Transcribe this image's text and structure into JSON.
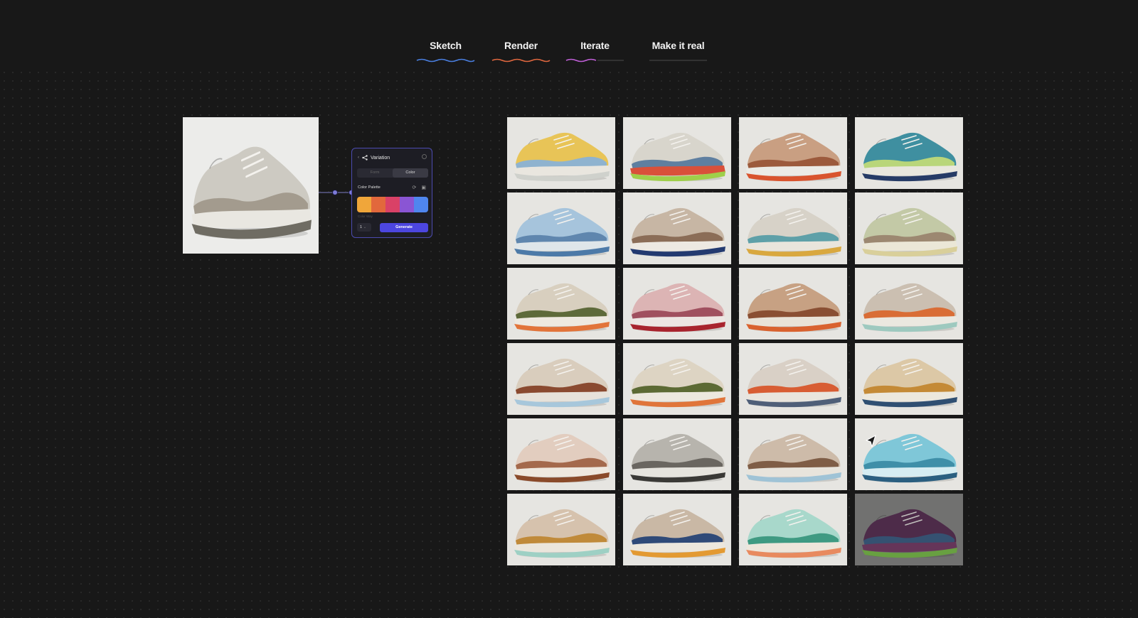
{
  "tabs": [
    {
      "label": "Sketch",
      "color": "#4a7fe0"
    },
    {
      "label": "Render",
      "color": "#e0673f"
    },
    {
      "label": "Iterate",
      "color": "#c05fd8"
    },
    {
      "label": "Make it real",
      "color": "#3a3a3a"
    }
  ],
  "panel": {
    "title": "Variation",
    "mode_options": [
      "Form",
      "Color"
    ],
    "selected_mode": "Color",
    "section_title": "Color Palette",
    "palette": [
      "#f0a63a",
      "#e2683c",
      "#d94167",
      "#8a55d4",
      "#4f86ef"
    ],
    "sub_label": "Color Way",
    "count": "1",
    "generate_label": "Generate",
    "accent": "#4c46e0"
  },
  "source": {
    "colors": [
      "#cdcac2",
      "#a39b8e",
      "#e9e7e1",
      "#6f6c63"
    ]
  },
  "variations": [
    {
      "colors": [
        "#e8c457",
        "#8fb3cf",
        "#e9e6df",
        "#cfd1cc"
      ]
    },
    {
      "colors": [
        "#d8d5cc",
        "#5f7fa0",
        "#d9503a",
        "#9fcf4a"
      ]
    },
    {
      "colors": [
        "#c99f82",
        "#9c5a3c",
        "#ecebe6",
        "#d9542e"
      ]
    },
    {
      "colors": [
        "#3f8fa0",
        "#b9d67a",
        "#e9e7de",
        "#263b66"
      ]
    },
    {
      "colors": [
        "#a6c4dc",
        "#5f86ae",
        "#dfe6ea",
        "#4d7aa8"
      ]
    },
    {
      "colors": [
        "#c7b6a4",
        "#8b6d57",
        "#ede9e2",
        "#233a70"
      ]
    },
    {
      "colors": [
        "#d7d2c8",
        "#5ea0a8",
        "#e9e5dc",
        "#d9a83f"
      ]
    },
    {
      "colors": [
        "#c3c9a6",
        "#9c8871",
        "#ebe7d7",
        "#d9cf9a"
      ]
    },
    {
      "colors": [
        "#d8cfbf",
        "#5e6a3a",
        "#eee9e0",
        "#e2743a"
      ]
    },
    {
      "colors": [
        "#dcb4b4",
        "#a0505f",
        "#ede6e3",
        "#a8242e"
      ]
    },
    {
      "colors": [
        "#c7a183",
        "#8a4f33",
        "#e9e3d8",
        "#d9622f"
      ]
    },
    {
      "colors": [
        "#cbbfb1",
        "#d96d36",
        "#ebe8e0",
        "#9ec9bf"
      ]
    },
    {
      "colors": [
        "#d9cdbd",
        "#8a4a30",
        "#e7e2da",
        "#a7c7db"
      ]
    },
    {
      "colors": [
        "#ddd4c3",
        "#5c6a34",
        "#ece8de",
        "#e0753a"
      ]
    },
    {
      "colors": [
        "#d9d0c6",
        "#d85d33",
        "#e9e5dd",
        "#4f5f78"
      ]
    },
    {
      "colors": [
        "#dcc8a6",
        "#c48a36",
        "#ece8dd",
        "#2f4f72"
      ]
    },
    {
      "colors": [
        "#e2cdbf",
        "#a4694c",
        "#efe8df",
        "#8a4a2a"
      ]
    },
    {
      "colors": [
        "#b7b4ad",
        "#6a6660",
        "#e6e4de",
        "#3a3936"
      ]
    },
    {
      "colors": [
        "#cdbba9",
        "#7f5d46",
        "#e8e4dc",
        "#9fc3d6"
      ]
    },
    {
      "colors": [
        "#7fc7d8",
        "#3f8fa8",
        "#d6edf2",
        "#2b5f80"
      ]
    },
    {
      "colors": [
        "#d6c2ad",
        "#c08a3a",
        "#ebe6dc",
        "#9ed0c4"
      ]
    },
    {
      "colors": [
        "#c9b8a5",
        "#2f4a78",
        "#ece7dd",
        "#e39a32"
      ]
    },
    {
      "colors": [
        "#a8d8cb",
        "#3f9a82",
        "#eee6db",
        "#e88a5f"
      ]
    },
    {
      "colors": [
        "#5a2d55",
        "#3a5f8a",
        "#7a3a6a",
        "#7ec84a"
      ]
    }
  ]
}
